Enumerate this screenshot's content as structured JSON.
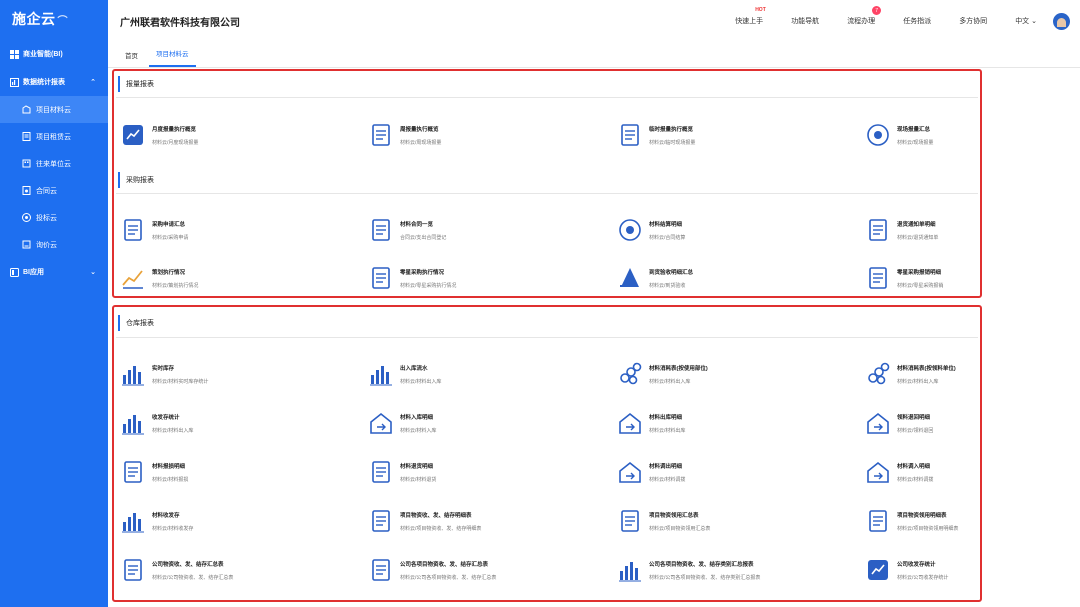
{
  "app": {
    "logo": "施企云",
    "company": "广州联君软件科技有限公司"
  },
  "sidebar": {
    "groups": [
      {
        "label": "商业智能(BI)"
      },
      {
        "label": "数据统计报表",
        "chevron": "⌃"
      },
      {
        "label": "BI应用",
        "chevron": "⌄"
      }
    ],
    "items": [
      {
        "label": "项目材料云",
        "active": true
      },
      {
        "label": "项目租赁云"
      },
      {
        "label": "往来单位云"
      },
      {
        "label": "合同云"
      },
      {
        "label": "投标云"
      },
      {
        "label": "询价云"
      }
    ]
  },
  "topbar": {
    "actions": [
      {
        "label": "快速上手",
        "hot": "HOT"
      },
      {
        "label": "功能导航"
      },
      {
        "label": "流程办理",
        "badge": "7"
      },
      {
        "label": "任务指派"
      },
      {
        "label": "多方协同"
      }
    ],
    "lang": "中文 ⌄"
  },
  "tabs": [
    {
      "label": "首页"
    },
    {
      "label": "项目材料云",
      "active": true
    }
  ],
  "sections": [
    {
      "title": "报量报表",
      "items": [
        {
          "title": "月度报量执行概览",
          "sub": "材料云/月度现场报量",
          "icon": "chart-box-icon"
        },
        {
          "title": "周报量执行概览",
          "sub": "材料云/周现场报量",
          "icon": "clipboard-arrow-icon"
        },
        {
          "title": "临时报量执行概览",
          "sub": "材料云/临时现场报量",
          "icon": "doc-pen-icon"
        },
        {
          "title": "现场报量汇总",
          "sub": "材料云/现场报量",
          "icon": "pie-doc-icon"
        }
      ]
    },
    {
      "title": "采购报表",
      "items": [
        {
          "title": "采购申请汇总",
          "sub": "材料云/采购申请",
          "icon": "edit-doc-icon"
        },
        {
          "title": "材料合同一览",
          "sub": "合同云/支出合同登记",
          "icon": "contract-icon"
        },
        {
          "title": "材料结算明细",
          "sub": "材料云/合同结算",
          "icon": "settle-circle-icon"
        },
        {
          "title": "退货通知单明细",
          "sub": "材料云/退货通知单",
          "icon": "return-doc-icon"
        },
        {
          "title": "策划执行情况",
          "sub": "材料云/策划执行情况",
          "icon": "line-trend-icon"
        },
        {
          "title": "零星采购执行情况",
          "sub": "材料云/零星采购执行情况",
          "icon": "cart-doc-icon"
        },
        {
          "title": "到货验收明细汇总",
          "sub": "材料云/到货验收",
          "icon": "triangle-stack-icon"
        },
        {
          "title": "零星采购报销明细",
          "sub": "材料云/零星采购报销",
          "icon": "receipt-cart-icon"
        }
      ]
    },
    {
      "title": "仓库报表",
      "items": [
        {
          "title": "实时库存",
          "sub": "材料云/材料实时库存统计",
          "icon": "bar-stats-icon"
        },
        {
          "title": "出入库流水",
          "sub": "材料云/材料出入库",
          "icon": "flow-bars-icon"
        },
        {
          "title": "材料消耗表(按使用部位)",
          "sub": "材料云/材料出入库",
          "icon": "pipes-icon"
        },
        {
          "title": "材料消耗表(按领料单位)",
          "sub": "材料云/材料出入库",
          "icon": "pipes-icon"
        },
        {
          "title": "收发存统计",
          "sub": "材料云/材料出入库",
          "icon": "gauge-bars-icon"
        },
        {
          "title": "材料入库明细",
          "sub": "材料云/材料入库",
          "icon": "house-in-icon"
        },
        {
          "title": "材料出库明细",
          "sub": "材料云/材料出库",
          "icon": "house-out-icon"
        },
        {
          "title": "领料退回明细",
          "sub": "材料云/领料退回",
          "icon": "house-circle-icon"
        },
        {
          "title": "材料报损明细",
          "sub": "材料云/材料报损",
          "icon": "edit-list-icon"
        },
        {
          "title": "材料退货明细",
          "sub": "材料云/材料退货",
          "icon": "person-doc-icon"
        },
        {
          "title": "材料调出明细",
          "sub": "材料云/材料调拨",
          "icon": "building-out-icon"
        },
        {
          "title": "材料调入明细",
          "sub": "材料云/材料调拨",
          "icon": "building-in-icon"
        },
        {
          "title": "材料收发存",
          "sub": "材料云/材料收发存",
          "icon": "bar-doc-icon"
        },
        {
          "title": "项目物资收、发、结存明细表",
          "sub": "材料云/项目物资收、发、结存明细表",
          "icon": "trend-doc-icon"
        },
        {
          "title": "项目物资领用汇总表",
          "sub": "材料云/项目物资领用汇总表",
          "icon": "box-doc-icon"
        },
        {
          "title": "项目物资领用明细表",
          "sub": "材料云/项目物资领用明细表",
          "icon": "list-doc-icon"
        },
        {
          "title": "公司物资收、发、结存汇总表",
          "sub": "材料云/公司物资收、发、结存汇总表",
          "icon": "transfer-doc-icon"
        },
        {
          "title": "公司各项目物资收、发、结存汇总表",
          "sub": "材料云/公司各项目物资收、发、结存汇总表",
          "icon": "multi-doc-icon"
        },
        {
          "title": "公司各项目物资收、发、结存类别汇总报表",
          "sub": "材料云/公司各项目物资收、发、结存类别汇总报表",
          "icon": "city-bars-icon"
        },
        {
          "title": "公司收发存统计",
          "sub": "材料云/公司收发存统计",
          "icon": "trend-screen-icon"
        }
      ]
    }
  ],
  "colors": {
    "primary": "#1e6ff0",
    "highlight": "#e03030",
    "iconBlue": "#2b5fc4"
  }
}
